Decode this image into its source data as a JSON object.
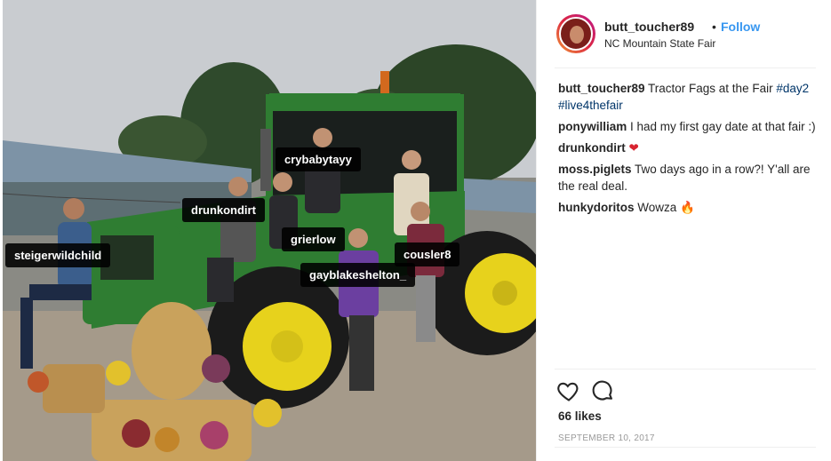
{
  "post": {
    "username": "butt_toucher89",
    "dot": "•",
    "follow_label": "Follow",
    "location": "NC Mountain State Fair"
  },
  "photo_tags": [
    "crybabytayy",
    "drunkondirt",
    "steigerwildchild",
    "grierlow",
    "cousler8",
    "gayblakeshelton_"
  ],
  "comments": [
    {
      "user": "butt_toucher89",
      "text": "Tractor Fags at the Fair ",
      "hashtags": "#day2 #live4thefair"
    },
    {
      "user": "ponywilliam",
      "text": "I had my first gay date at that fair :)"
    },
    {
      "user": "drunkondirt",
      "text": "❤"
    },
    {
      "user": "moss.piglets",
      "text": "Two days ago in a row?! Y'all are the real deal."
    },
    {
      "user": "hunkydoritos",
      "text": "Wowza 🔥"
    }
  ],
  "likes": "66 likes",
  "date": "SEPTEMBER 10, 2017",
  "icons": {
    "like": "heart-icon",
    "comment": "comment-icon"
  },
  "colors": {
    "follow": "#3897f0",
    "hashtag": "#003569",
    "tractor": "#2f7d32",
    "rim": "#e7d21c"
  }
}
